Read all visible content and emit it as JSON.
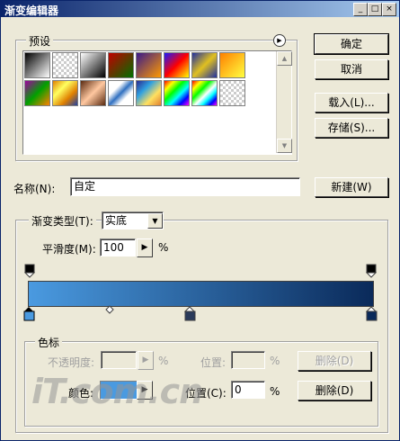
{
  "window": {
    "title": "渐变编辑器",
    "min_glyph": "_",
    "max_glyph": "□",
    "close_glyph": "×"
  },
  "presets": {
    "label": "预设",
    "menu_glyph": "▶",
    "scroll_up": "▲",
    "scroll_down": "▼"
  },
  "buttons": {
    "ok": "确定",
    "cancel": "取消",
    "load": "载入(L)...",
    "save": "存储(S)...",
    "new": "新建(W)",
    "delete_opacity": "删除(D)",
    "delete_color": "删除(D)"
  },
  "name": {
    "label": "名称(N):",
    "value": "自定"
  },
  "gradient_type": {
    "label": "渐变类型(T):",
    "value": "实底",
    "arrow": "▼"
  },
  "smoothness": {
    "label": "平滑度(M):",
    "value": "100",
    "unit": "%",
    "arrow": "▶"
  },
  "stops": {
    "group_label": "色标",
    "opacity_label": "不透明度:",
    "opacity_unit": "%",
    "opacity_arrow": "▶",
    "location_label": "位置:",
    "location_unit": "%",
    "color_label": "颜色:",
    "color_arrow": "▶",
    "color_location_label": "位置(C):",
    "color_location_value": "0",
    "color_location_unit": "%"
  },
  "watermark": "iT.com.cn",
  "colors": {
    "start": "#4a9ae0",
    "end": "#0a2a5a",
    "selected_swatch": "#4a9ae0"
  }
}
